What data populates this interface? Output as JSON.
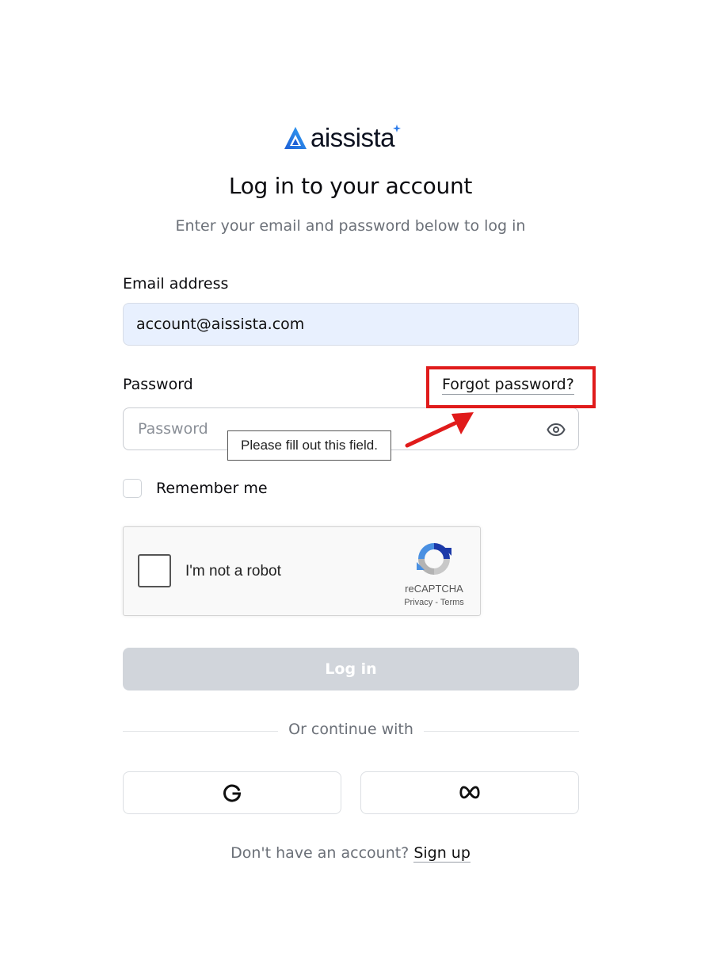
{
  "brand": {
    "name": "aissista",
    "accent": "#2f7dea"
  },
  "header": {
    "title": "Log in to your account",
    "subtitle": "Enter your email and password below to log in"
  },
  "form": {
    "email_label": "Email address",
    "email_value": "account@aissista.com",
    "password_label": "Password",
    "password_placeholder": "Password",
    "forgot_label": "Forgot password?",
    "validation_tooltip": "Please fill out this field.",
    "remember_label": "Remember me",
    "remember_checked": false,
    "login_label": "Log in"
  },
  "recaptcha": {
    "label": "I'm not a robot",
    "brand": "reCAPTCHA",
    "links": "Privacy - Terms"
  },
  "social": {
    "divider_label": "Or continue with",
    "providers": [
      {
        "name": "google",
        "icon": "google-icon"
      },
      {
        "name": "meta",
        "icon": "meta-icon"
      }
    ]
  },
  "footer": {
    "prompt": "Don't have an account?",
    "signup_label": "Sign up"
  },
  "annotation": {
    "color": "#e01b1b"
  }
}
